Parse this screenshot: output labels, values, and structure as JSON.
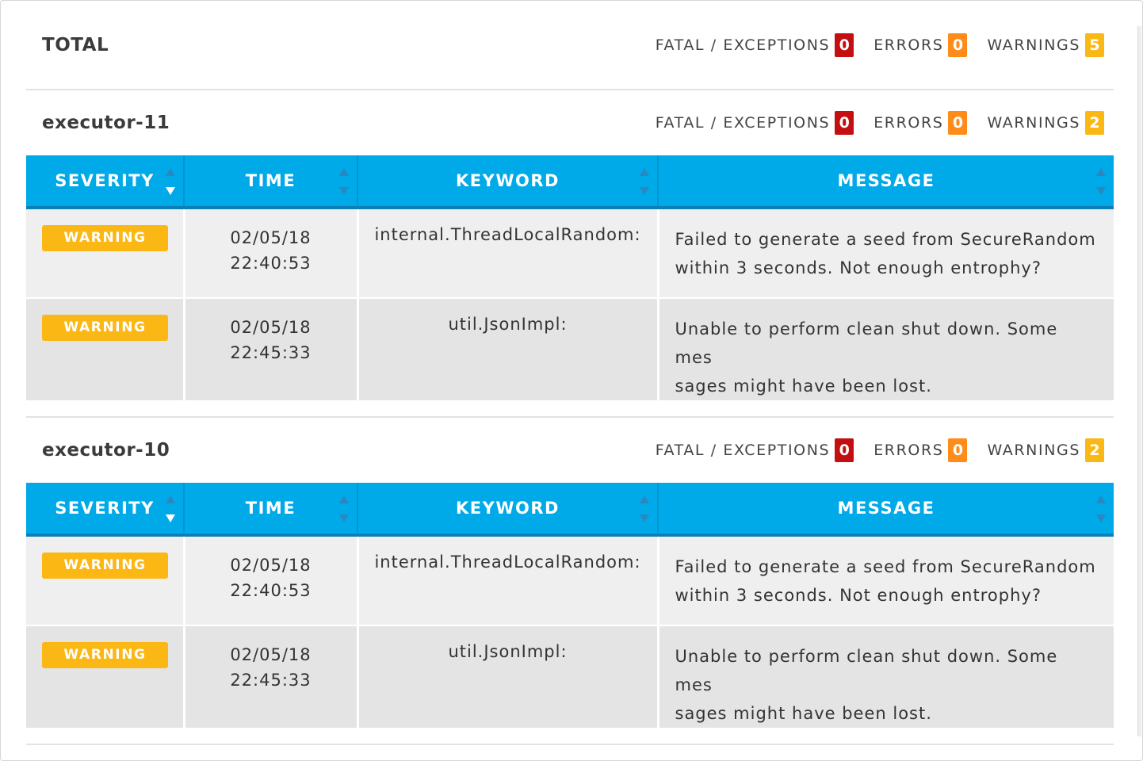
{
  "total": {
    "label": "TOTAL",
    "fatal_label": "FATAL / EXCEPTIONS",
    "fatal_count": "0",
    "errors_label": "ERRORS",
    "errors_count": "0",
    "warnings_label": "WARNINGS",
    "warnings_count": "5"
  },
  "columns": {
    "severity": "SEVERITY",
    "time": "TIME",
    "keyword": "KEYWORD",
    "message": "MESSAGE"
  },
  "colors": {
    "header_blue": "#00a9e8",
    "fatal": "#c40f12",
    "errors": "#ff8c1a",
    "warnings": "#fbb714"
  },
  "executors": [
    {
      "name": "executor-11",
      "fatal_label": "FATAL / EXCEPTIONS",
      "fatal_count": "0",
      "errors_label": "ERRORS",
      "errors_count": "0",
      "warnings_label": "WARNINGS",
      "warnings_count": "2",
      "rows": [
        {
          "severity": "WARNING",
          "date": "02/05/18",
          "time": "22:40:53",
          "keyword": "internal.ThreadLocalRandom:",
          "message_line1": "Failed to generate a seed from SecureRandom",
          "message_line2": "within 3 seconds. Not enough entrophy?"
        },
        {
          "severity": "WARNING",
          "date": "02/05/18",
          "time": "22:45:33",
          "keyword": "util.JsonImpl:",
          "message_line1": "Unable to perform clean shut down. Some mes",
          "message_line2": "sages might have been lost."
        }
      ]
    },
    {
      "name": "executor-10",
      "fatal_label": "FATAL / EXCEPTIONS",
      "fatal_count": "0",
      "errors_label": "ERRORS",
      "errors_count": "0",
      "warnings_label": "WARNINGS",
      "warnings_count": "2",
      "rows": [
        {
          "severity": "WARNING",
          "date": "02/05/18",
          "time": "22:40:53",
          "keyword": "internal.ThreadLocalRandom:",
          "message_line1": "Failed to generate a seed from SecureRandom",
          "message_line2": "within 3 seconds. Not enough entrophy?"
        },
        {
          "severity": "WARNING",
          "date": "02/05/18",
          "time": "22:45:33",
          "keyword": "util.JsonImpl:",
          "message_line1": "Unable to perform clean shut down. Some mes",
          "message_line2": "sages might have been lost."
        }
      ]
    }
  ]
}
